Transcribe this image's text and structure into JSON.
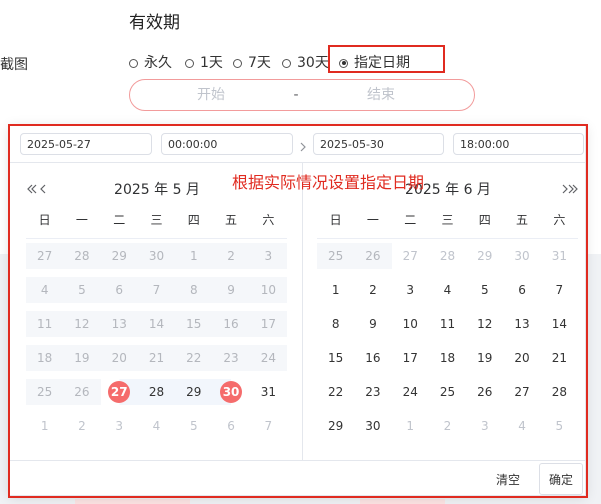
{
  "colors": {
    "accent": "#f56c6c",
    "annotation": "#e02b20",
    "range_border": "#f29b9b"
  },
  "icons": {
    "prev_year": "double-left-icon",
    "prev_month": "chevron-left-icon",
    "next_month": "chevron-right-icon",
    "next_year": "double-right-icon",
    "range_arrow": "chevron-right-icon"
  },
  "form": {
    "left_label": "截图",
    "validity_title": "有效期",
    "options": [
      {
        "label": "永久",
        "checked": false
      },
      {
        "label": "1天",
        "checked": false
      },
      {
        "label": "7天",
        "checked": false
      },
      {
        "label": "30天",
        "checked": false
      },
      {
        "label": "指定日期",
        "checked": true
      }
    ],
    "range": {
      "start_placeholder": "开始",
      "separator": "-",
      "end_placeholder": "结束"
    }
  },
  "picker": {
    "start_date": "2025-05-27",
    "start_time": "00:00:00",
    "end_date": "2025-05-30",
    "end_time": "18:00:00",
    "annotation": "根据实际情况设置指定日期",
    "weekdays": [
      "日",
      "一",
      "二",
      "三",
      "四",
      "五",
      "六"
    ],
    "left": {
      "title": "2025 年 5 月",
      "rows": [
        [
          {
            "d": 27,
            "disabled": true
          },
          {
            "d": 28,
            "disabled": true
          },
          {
            "d": 29,
            "disabled": true
          },
          {
            "d": 30,
            "disabled": true
          },
          {
            "d": 1,
            "disabled": true
          },
          {
            "d": 2,
            "disabled": true
          },
          {
            "d": 3,
            "disabled": true
          }
        ],
        [
          {
            "d": 4,
            "disabled": true
          },
          {
            "d": 5,
            "disabled": true
          },
          {
            "d": 6,
            "disabled": true
          },
          {
            "d": 7,
            "disabled": true
          },
          {
            "d": 8,
            "disabled": true
          },
          {
            "d": 9,
            "disabled": true
          },
          {
            "d": 10,
            "disabled": true
          }
        ],
        [
          {
            "d": 11,
            "disabled": true
          },
          {
            "d": 12,
            "disabled": true
          },
          {
            "d": 13,
            "disabled": true
          },
          {
            "d": 14,
            "disabled": true
          },
          {
            "d": 15,
            "disabled": true
          },
          {
            "d": 16,
            "disabled": true
          },
          {
            "d": 17,
            "disabled": true
          }
        ],
        [
          {
            "d": 18,
            "disabled": true
          },
          {
            "d": 19,
            "disabled": true
          },
          {
            "d": 20,
            "disabled": true
          },
          {
            "d": 21,
            "disabled": true
          },
          {
            "d": 22,
            "disabled": true
          },
          {
            "d": 23,
            "disabled": true
          },
          {
            "d": 24,
            "disabled": true
          }
        ],
        [
          {
            "d": 25,
            "disabled": true
          },
          {
            "d": 26,
            "disabled": true
          },
          {
            "d": 27,
            "start": true
          },
          {
            "d": 28,
            "in_range": true
          },
          {
            "d": 29,
            "in_range": true
          },
          {
            "d": 30,
            "end": true
          },
          {
            "d": 31
          }
        ],
        [
          {
            "d": 1,
            "other": true
          },
          {
            "d": 2,
            "other": true
          },
          {
            "d": 3,
            "other": true
          },
          {
            "d": 4,
            "other": true
          },
          {
            "d": 5,
            "other": true
          },
          {
            "d": 6,
            "other": true
          },
          {
            "d": 7,
            "other": true
          }
        ]
      ]
    },
    "right": {
      "title": "2025 年 6 月",
      "rows": [
        [
          {
            "d": 25,
            "disabled": true
          },
          {
            "d": 26,
            "disabled": true
          },
          {
            "d": 27,
            "other": true
          },
          {
            "d": 28,
            "other": true
          },
          {
            "d": 29,
            "other": true
          },
          {
            "d": 30,
            "other": true
          },
          {
            "d": 31,
            "other": true
          }
        ],
        [
          {
            "d": 1
          },
          {
            "d": 2
          },
          {
            "d": 3
          },
          {
            "d": 4
          },
          {
            "d": 5
          },
          {
            "d": 6
          },
          {
            "d": 7
          }
        ],
        [
          {
            "d": 8
          },
          {
            "d": 9
          },
          {
            "d": 10
          },
          {
            "d": 11
          },
          {
            "d": 12
          },
          {
            "d": 13
          },
          {
            "d": 14
          }
        ],
        [
          {
            "d": 15
          },
          {
            "d": 16
          },
          {
            "d": 17
          },
          {
            "d": 18
          },
          {
            "d": 19
          },
          {
            "d": 20
          },
          {
            "d": 21
          }
        ],
        [
          {
            "d": 22
          },
          {
            "d": 23
          },
          {
            "d": 24
          },
          {
            "d": 25
          },
          {
            "d": 26
          },
          {
            "d": 27
          },
          {
            "d": 28
          }
        ],
        [
          {
            "d": 29
          },
          {
            "d": 30
          },
          {
            "d": 1,
            "other": true
          },
          {
            "d": 2,
            "other": true
          },
          {
            "d": 3,
            "other": true
          },
          {
            "d": 4,
            "other": true
          },
          {
            "d": 5,
            "other": true
          }
        ]
      ]
    },
    "clear_label": "清空",
    "confirm_label": "确定"
  }
}
